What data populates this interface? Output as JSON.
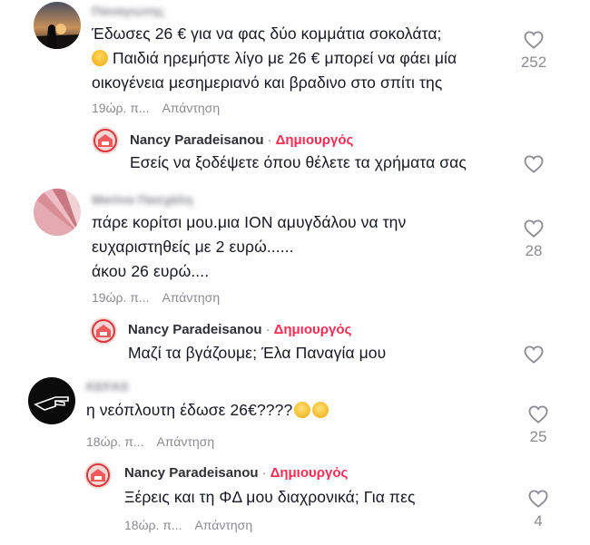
{
  "comments": [
    {
      "name": "Παναγιώτης",
      "text_lines": [
        "Έδωσες 26 € για να φας δύο κομμάτια σοκολάτα;",
        "Παιδιά ηρεμήστε λίγο με 26 € μπορεί να φάει μία",
        "οικογένεια μεσημεριανό και βραδινο στο σπίτι της"
      ],
      "time": "19ώρ. π...",
      "reply_label": "Απάντηση",
      "likes": "252",
      "emoji": "flushed-face-icon",
      "reply": {
        "name": "Nancy Paradeisanou",
        "separator": "·",
        "badge": "Δημιουργός",
        "text": "Εσείς να ξοδέψετε όπου θέλετε τα χρήματα σας"
      }
    },
    {
      "name": "Ματίνα Πασχάλη",
      "text_lines": [
        "πάρε κορίτσι μου.μια ΙΟΝ αμυγδάλου να την",
        "ευχαριστηθείς με 2 ευρώ......",
        "άκου 26 ευρώ...."
      ],
      "time": "19ώρ. π...",
      "reply_label": "Απάντηση",
      "likes": "28",
      "reply": {
        "name": "Nancy Paradeisanou",
        "separator": "·",
        "badge": "Δημιουργός",
        "text": "Μαζί τα βγάζουμε; Έλα Παναγία μου"
      }
    },
    {
      "name": "KEFAS",
      "text_lines": [
        "η νεόπλουτη έδωσε 26€????"
      ],
      "time": "18ώρ. π...",
      "reply_label": "Απάντηση",
      "likes": "25",
      "emoji": "grimacing-face-icon",
      "reply": {
        "name": "Nancy Paradeisanou",
        "separator": "·",
        "badge": "Δημιουργός",
        "text": "Ξέρεις και τη ΦΔ μου διαχρονικά; Για πες",
        "time": "18ώρ. π...",
        "reply_label": "Απάντηση",
        "likes": "4"
      }
    }
  ],
  "colors": {
    "creator_badge": "#fe2c55",
    "muted_text": "#8a8b91",
    "body_text": "#161823"
  }
}
